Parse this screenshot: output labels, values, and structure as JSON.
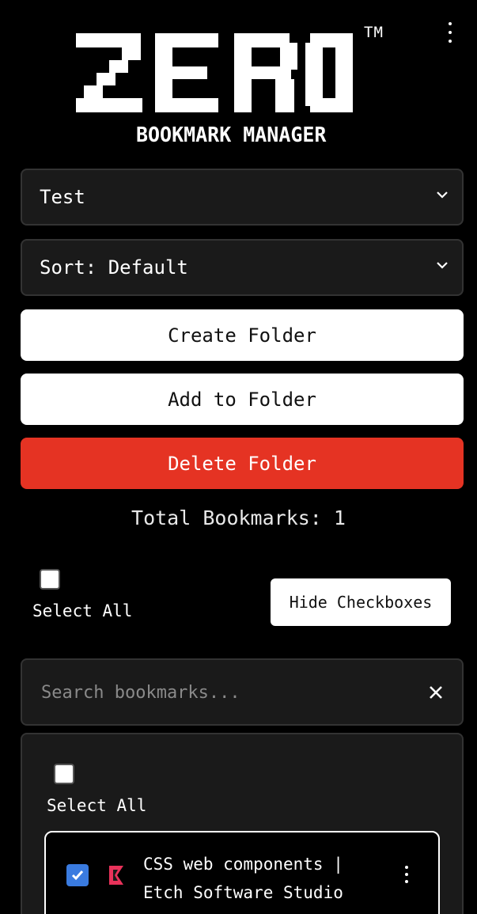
{
  "header": {
    "logo_text": "ZERO",
    "trademark": "TM",
    "subtitle": "BOOKMARK MANAGER",
    "menu_icon": "kebab-vertical-icon"
  },
  "folder_select": {
    "value": "Test",
    "icon": "chevron-down-icon"
  },
  "sort_select": {
    "value": "Sort: Default",
    "icon": "chevron-down-icon"
  },
  "buttons": {
    "create_folder": "Create Folder",
    "add_to_folder": "Add to Folder",
    "delete_folder": "Delete Folder",
    "hide_checkboxes": "Hide Checkboxes"
  },
  "total_bookmarks": "Total Bookmarks: 1",
  "select_all_label": "Select All",
  "search": {
    "placeholder": "Search bookmarks...",
    "value": "",
    "clear_icon": "close-icon"
  },
  "list": {
    "select_all_label": "Select All",
    "bookmarks": [
      {
        "title": "CSS web components | Etch Software Studio",
        "checked": true,
        "favicon": "etch-logo-icon",
        "menu_icon": "kebab-vertical-icon"
      }
    ]
  },
  "colors": {
    "background": "#000000",
    "panel": "#1a1a1a",
    "danger": "#e53323",
    "checkbox_checked": "#3a7be0"
  }
}
